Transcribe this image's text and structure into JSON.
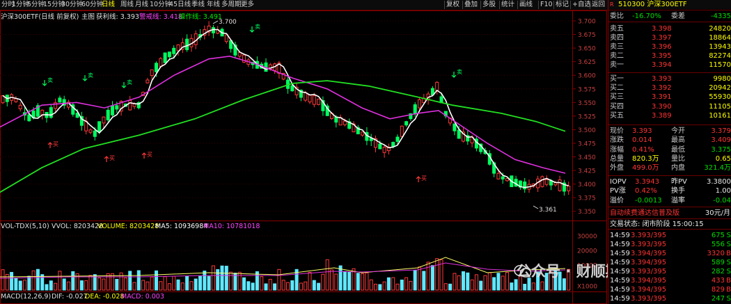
{
  "toolbar": {
    "left_items": [
      "分时",
      "1分钟",
      "5分钟",
      "15分钟",
      "30分钟",
      "60分钟",
      "日线",
      "周线",
      "月线",
      "10分钟",
      "45日线",
      "季线",
      "年线",
      "多周期",
      "更多"
    ],
    "active": "日线",
    "right_items": [
      "复权",
      "叠加",
      "多股",
      "统计",
      "画线",
      "F10",
      "标记",
      "+自选",
      "返回"
    ]
  },
  "chart_header": {
    "title": "沪深300ETF(日线 前复权)",
    "main_label": "主图",
    "support_label": "获利线: 3.393",
    "pressure_label": "警戒线: 3.418",
    "operate_label": "操作线: 3.491"
  },
  "price_axis": [
    "3.700",
    "3.675",
    "3.650",
    "3.625",
    "3.600",
    "3.575",
    "3.550",
    "3.525",
    "3.500",
    "3.475",
    "3.450",
    "3.425",
    "3.400",
    "3.375",
    "3.350"
  ],
  "annotations": {
    "high": "3.700",
    "low": "3.361",
    "buy": "买",
    "sell": "卖"
  },
  "volume_header": {
    "name": "VOL-TDX(5,10)",
    "vvol": "VVOL: 8203428",
    "volume": "VOLUME: 8203428",
    "ma5": "MA5: 10936984",
    "ma10": "MA10: 10781018"
  },
  "volume_axis": [
    "30000",
    "20000",
    "10000",
    "X1000"
  ],
  "macd_header": {
    "name": "MACD(12,26,9)",
    "dif": "DIF: -0.027",
    "dea": "DEA: -0.028",
    "macd": "MACD: 0.003"
  },
  "quote": {
    "code_name": "510300 沪深300ETF",
    "webi_label": "委比",
    "webi_value": "-16.70%",
    "wecha_label": "委差",
    "wecha_value": "-4335",
    "asks": [
      {
        "label": "卖五",
        "price": "3.398",
        "vol": "24820"
      },
      {
        "label": "卖四",
        "price": "3.397",
        "vol": "18864"
      },
      {
        "label": "卖三",
        "price": "3.396",
        "vol": "13943"
      },
      {
        "label": "卖二",
        "price": "3.395",
        "vol": "82274"
      },
      {
        "label": "卖一",
        "price": "3.394",
        "vol": "11570"
      }
    ],
    "bids": [
      {
        "label": "买一",
        "price": "3.393",
        "vol": "9980"
      },
      {
        "label": "买二",
        "price": "3.392",
        "vol": "20942"
      },
      {
        "label": "买三",
        "price": "3.391",
        "vol": "55930"
      },
      {
        "label": "买四",
        "price": "3.390",
        "vol": "11105"
      },
      {
        "label": "买五",
        "price": "3.389",
        "vol": "10161"
      }
    ],
    "stats": [
      {
        "l1": "现价",
        "v1": "3.393",
        "l2": "今开",
        "v2": "3.379"
      },
      {
        "l1": "涨跌",
        "v1": "0.014",
        "l2": "最高",
        "v2": "3.409"
      },
      {
        "l1": "涨幅",
        "v1": "0.41%",
        "l2": "最低",
        "v2": "3.375"
      },
      {
        "l1": "总量",
        "v1": "820.3万",
        "l2": "量比",
        "v2": "0.65"
      },
      {
        "l1": "外盘",
        "v1": "499.0万",
        "l2": "内盘",
        "v2": "321.4万"
      }
    ],
    "iopv": [
      {
        "l1": "IOPV",
        "v1": "3.3943",
        "l2": "昨PV",
        "v2": "3.3800"
      },
      {
        "l1": "PV涨",
        "v1": "0.42%",
        "l2": "换手",
        "v2": "1.00"
      },
      {
        "l1": "溢价",
        "v1": "-0.0013",
        "l2": "溢率",
        "v2": "-0.04"
      }
    ],
    "promo": "自动续费通达信普及版",
    "promo_price": "30元/月",
    "status": "交易状态: 闭市阶段 15:00:15",
    "ticks": [
      {
        "time": "14:59",
        "price": "3.393/395",
        "vol": "675",
        "bs": "S"
      },
      {
        "time": "14:59",
        "price": "3.393/395",
        "vol": "556",
        "bs": "S"
      },
      {
        "time": "14:59",
        "price": "3.394/395",
        "vol": "3320",
        "bs": "B"
      },
      {
        "time": "14:59",
        "price": "3.394/395",
        "vol": "589",
        "bs": "S"
      },
      {
        "time": "14:59",
        "price": "3.393/395",
        "vol": "282",
        "bs": "S"
      },
      {
        "time": "14:59",
        "price": "3.394/395",
        "vol": "433",
        "bs": "B"
      },
      {
        "time": "14:59",
        "price": "3.394/395",
        "vol": "829",
        "bs": "B"
      },
      {
        "time": "14:59",
        "price": "3.393/395",
        "vol": "247",
        "bs": "S"
      }
    ]
  },
  "watermark": "公众号 · 财顺期权"
}
